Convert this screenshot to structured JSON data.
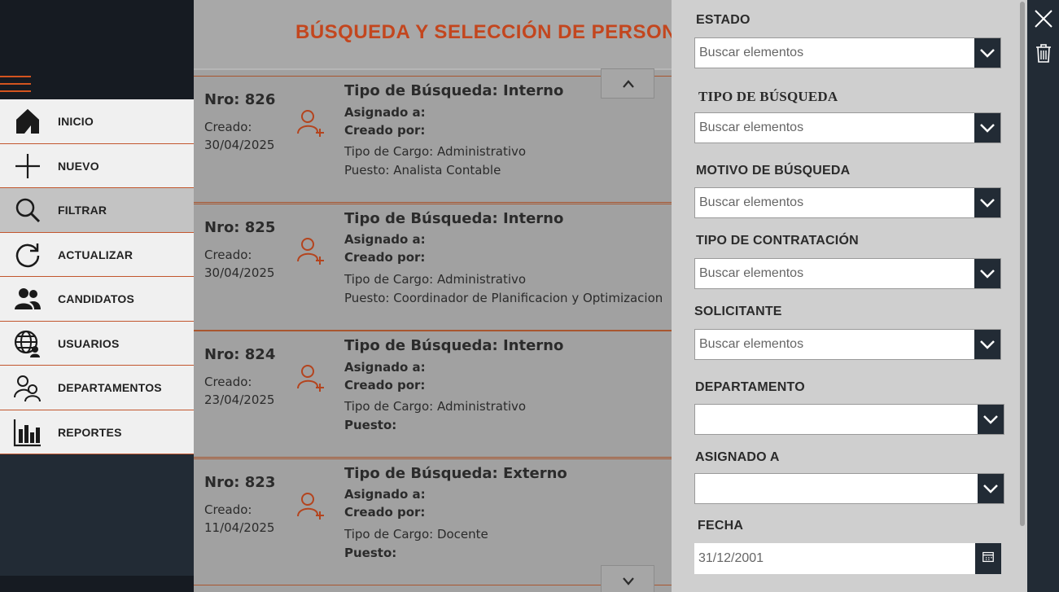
{
  "nav": {
    "items": [
      {
        "label": "INICIO",
        "icon": "home-icon"
      },
      {
        "label": "NUEVO",
        "icon": "plus-icon"
      },
      {
        "label": "FILTRAR",
        "icon": "search-icon"
      },
      {
        "label": "ACTUALIZAR",
        "icon": "refresh-icon"
      },
      {
        "label": "CANDIDATOS",
        "icon": "people-icon"
      },
      {
        "label": "USUARIOS",
        "icon": "globe-user-icon"
      },
      {
        "label": "DEPARTAMENTOS",
        "icon": "group-outline-icon"
      },
      {
        "label": "REPORTES",
        "icon": "bar-chart-icon"
      }
    ],
    "active": "FILTRAR"
  },
  "main": {
    "title": "BÚSQUEDA Y SELECCIÓN DE PERSONAL",
    "records": [
      {
        "nro": "Nro: 826",
        "created_label": "Creado:",
        "created_date": "30/04/2025",
        "tipo_busqueda": "Tipo de Búsqueda: Interno",
        "asignado": "Asignado a:",
        "creado_por": "Creado por:",
        "tipo_cargo": "Tipo de Cargo: Administrativo",
        "puesto": "Puesto: Analista Contable"
      },
      {
        "nro": "Nro: 825",
        "created_label": "Creado:",
        "created_date": "30/04/2025",
        "tipo_busqueda": "Tipo de Búsqueda: Interno",
        "asignado": "Asignado a:",
        "creado_por": "Creado por:",
        "tipo_cargo": "Tipo de Cargo: Administrativo",
        "puesto": "Puesto: Coordinador de Planificacion y Optimizacion"
      },
      {
        "nro": "Nro: 824",
        "created_label": "Creado:",
        "created_date": "23/04/2025",
        "tipo_busqueda": "Tipo de Búsqueda: Interno",
        "asignado": "Asignado a:",
        "creado_por": "Creado por:",
        "tipo_cargo": "Tipo de Cargo: Administrativo",
        "puesto": "Puesto:"
      },
      {
        "nro": "Nro: 823",
        "created_label": "Creado:",
        "created_date": "11/04/2025",
        "tipo_busqueda": "Tipo de Búsqueda: Externo",
        "asignado": "Asignado a:",
        "creado_por": "Creado por:",
        "tipo_cargo": "Tipo de Cargo: Docente",
        "puesto": "Puesto:"
      }
    ]
  },
  "filters": {
    "estado": {
      "label": "ESTADO",
      "placeholder": "Buscar elementos"
    },
    "tipo_busqueda": {
      "label": "TIPO DE BÚSQUEDA",
      "placeholder": "Buscar elementos"
    },
    "motivo": {
      "label": "MOTIVO DE BÚSQUEDA",
      "placeholder": "Buscar elementos"
    },
    "tipo_contratacion": {
      "label": "TIPO DE CONTRATACIÓN",
      "placeholder": "Buscar elementos"
    },
    "solicitante": {
      "label": "SOLICITANTE",
      "placeholder": "Buscar elementos"
    },
    "departamento": {
      "label": "DEPARTAMENTO",
      "value": ""
    },
    "asignado_a": {
      "label": "ASIGNADO A",
      "value": ""
    },
    "fecha": {
      "label": "FECHA",
      "value": "31/12/2001"
    }
  },
  "toolbar": {
    "close_icon": "close-icon",
    "delete_icon": "trash-icon"
  },
  "colors": {
    "accent": "#c3461e",
    "dark": "#222b35",
    "panel": "#cfcfcf"
  }
}
